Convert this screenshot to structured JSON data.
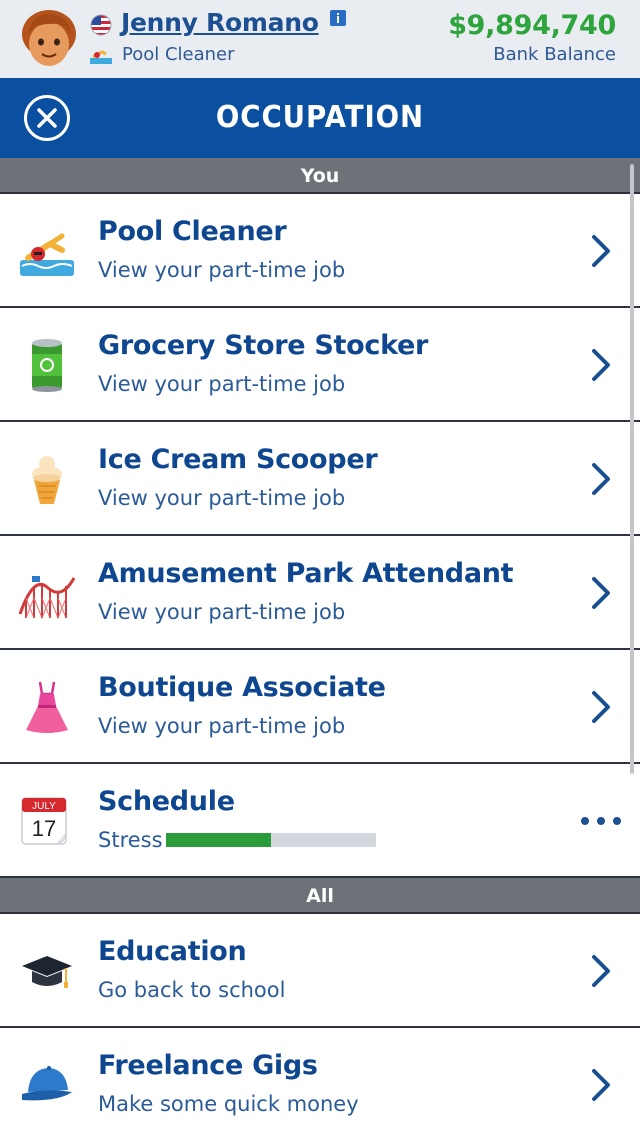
{
  "header": {
    "player_name": "Jenny Romano",
    "job": "Pool Cleaner",
    "balance": "$9,894,740",
    "balance_label": "Bank Balance",
    "icons": [
      "avatar",
      "us-flag-icon",
      "info-icon",
      "swimmer-icon"
    ]
  },
  "title_bar": {
    "title": "OCCUPATION",
    "close_icon": "close-icon"
  },
  "sections": {
    "you": "You",
    "all": "All"
  },
  "you_items": [
    {
      "title": "Pool Cleaner",
      "subtitle": "View your part-time job",
      "icon": "swimmer-icon"
    },
    {
      "title": "Grocery Store Stocker",
      "subtitle": "View your part-time job",
      "icon": "can-icon"
    },
    {
      "title": "Ice Cream Scooper",
      "subtitle": "View your part-time job",
      "icon": "ice-cream-icon"
    },
    {
      "title": "Amusement Park Attendant",
      "subtitle": "View your part-time job",
      "icon": "roller-coaster-icon"
    },
    {
      "title": "Boutique Associate",
      "subtitle": "View your part-time job",
      "icon": "dress-icon"
    }
  ],
  "schedule": {
    "title": "Schedule",
    "stress_label": "Stress",
    "stress_level": 0.5,
    "calendar_month": "JULY",
    "calendar_day": "17",
    "icon": "calendar-icon"
  },
  "all_items": [
    {
      "title": "Education",
      "subtitle": "Go back to school",
      "icon": "graduation-cap-icon"
    },
    {
      "title": "Freelance Gigs",
      "subtitle": "Make some quick money",
      "icon": "cap-icon"
    }
  ],
  "colors": {
    "title_bar": "#0a4fa0",
    "section_header": "#6c7278",
    "balance": "#2ea43c",
    "stress_fill": "#2c9b3b",
    "row_title": "#0e4690"
  }
}
